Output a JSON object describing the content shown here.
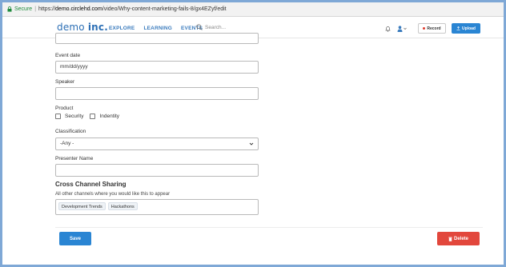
{
  "browser": {
    "secure_label": "Secure",
    "separator": "|",
    "url_scheme": "https://",
    "url_host": "demo.circlehd.com",
    "url_path": "/video/Why-content-marketing-fails-8/gx4EZyf/edit"
  },
  "header": {
    "logo_main": "demo",
    "logo_suffix": "inc.",
    "nav": [
      "EXPLORE",
      "LEARNING",
      "EVENTS"
    ],
    "search_placeholder": "Search...",
    "user_caret": "▾",
    "record_label": "Record",
    "upload_label": "Upload"
  },
  "form": {
    "event_date": {
      "label": "Event date",
      "placeholder": "mm/dd/yyyy"
    },
    "speaker": {
      "label": "Speaker",
      "value": ""
    },
    "product": {
      "label": "Product",
      "options": [
        {
          "label": "Security",
          "checked": false
        },
        {
          "label": "Indentity",
          "checked": false
        }
      ]
    },
    "classification": {
      "label": "Classification",
      "selected": "-Any -"
    },
    "presenter_name": {
      "label": "Presenter Name",
      "value": ""
    },
    "cross_channel": {
      "heading": "Cross Channel Sharing",
      "description": "All other channels where you would like this to appear",
      "tags": [
        "Development Trends",
        "Hackathons"
      ]
    },
    "save_label": "Save",
    "delete_label": "Delete"
  },
  "colors": {
    "accent": "#2a85d3",
    "danger": "#e2473c",
    "frame": "#7fa8d6",
    "secure": "#1e8a3c"
  },
  "icons": [
    "lock-icon",
    "search-icon",
    "bell-icon",
    "user-icon",
    "record-dot-icon",
    "upload-icon",
    "chevron-down-icon",
    "trash-icon"
  ]
}
